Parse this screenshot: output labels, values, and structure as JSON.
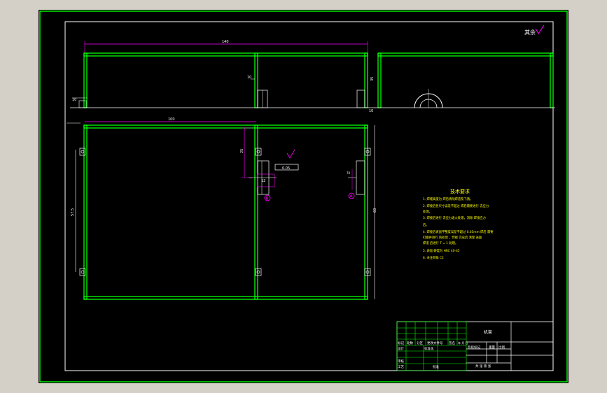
{
  "drawing": {
    "colors": {
      "background": "#000000",
      "frame": "#ffffff",
      "border": "#00ff00",
      "steel": "#00ff00",
      "dimension": "#ff00ff",
      "note_text": "#ffff00",
      "symbol": "#ff00ff",
      "annotation": "#ffffff"
    },
    "roughness_label": "其余",
    "dimensions": {
      "top_overall": "140",
      "top_side_height": "35",
      "top_offset": "10",
      "top_left_bottom": "10",
      "top_mid_bottom": "10",
      "plan_left": "100",
      "plan_right_width": "70",
      "plan_left_height": "57.5",
      "plan_right_height": "60",
      "plan_inner": "25",
      "plan_mid": "12"
    },
    "section_labels": {
      "view_a": "A",
      "view_b": "B"
    },
    "tolerance_box": "0.05",
    "notes": {
      "title": "技术要求",
      "lines": [
        "1. 焊缝高度为  焊后清除焊渣及飞溅。",
        "2. 焊接后各尺寸误差不超过  焊后需要进行 去应力",
        "   处理。",
        "3. 焊接后进行 去应力退火处理，消除 焊接应力",
        "   后。",
        "4. 焊接后表面平整度误差不超过 0.05mm 焊后 需要",
        "   打磨并进行 热处理 ，焊接 完成后 清理 表面",
        "   焊渣 后进行 T = 1 处理。",
        "5. 表面 硬度为 HRC 40-45",
        "6. 未注倒角 C2"
      ]
    },
    "title_block": {
      "drawing_name": "机架",
      "row_labels": [
        "标记",
        "处数",
        "分区",
        "更改文件号",
        "签名",
        "年 月 日"
      ],
      "designer": "设计",
      "standardized": "标准化",
      "review": "审核",
      "process": "工艺",
      "approve": "批准",
      "stage_mark": "阶段标记",
      "weight": "重量",
      "scale": "比例",
      "sheets": "共 张  第 张"
    }
  }
}
